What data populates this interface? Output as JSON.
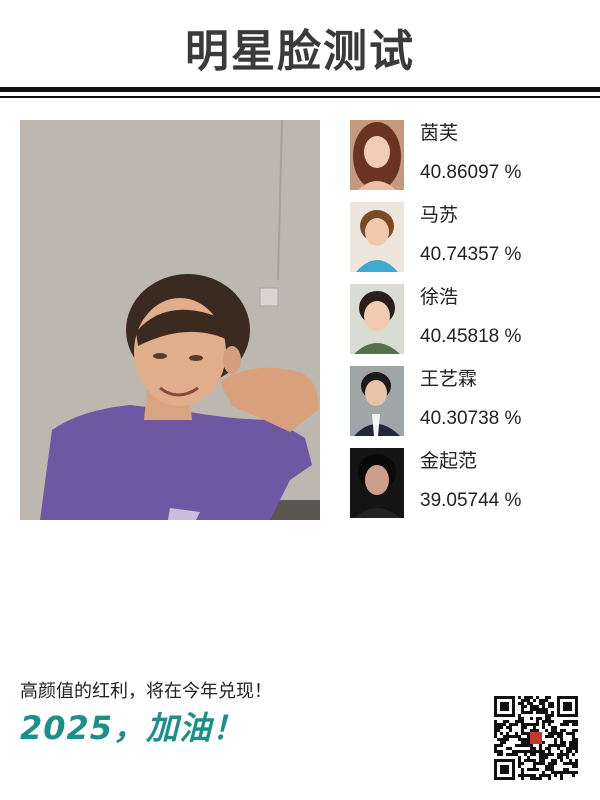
{
  "header": {
    "title": "明星脸测试"
  },
  "matches": [
    {
      "name": "茵芙",
      "score": "40.86097 %",
      "photo": "portrait-woman-long-hair"
    },
    {
      "name": "马苏",
      "score": "40.74357 %",
      "photo": "portrait-woman-short-hair"
    },
    {
      "name": "徐浩",
      "score": "40.45818 %",
      "photo": "portrait-young-man"
    },
    {
      "name": "王艺霖",
      "score": "40.30738 %",
      "photo": "portrait-man-suit"
    },
    {
      "name": "金起范",
      "score": "39.05744 %",
      "photo": "portrait-man-dark"
    }
  ],
  "footer": {
    "slogan": "高颜值的红利，将在今年兑现！",
    "slogan_big": "2025，加油！"
  },
  "colors": {
    "accent": "#1a9088",
    "title": "#3a3a3a",
    "rule": "#111111"
  }
}
